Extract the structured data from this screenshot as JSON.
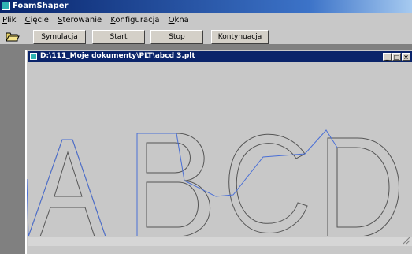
{
  "app": {
    "title": "FoamShaper"
  },
  "menu": [
    {
      "hotkey": "P",
      "rest": "lik"
    },
    {
      "hotkey": "C",
      "rest": "ięcie"
    },
    {
      "hotkey": "S",
      "rest": "terowanie"
    },
    {
      "hotkey": "K",
      "rest": "onfiguracja"
    },
    {
      "hotkey": "O",
      "rest": "kna"
    }
  ],
  "toolbar": {
    "open_icon": "folder-open-icon",
    "simulate_label": "Symulacja",
    "start_label": "Start",
    "stop_label": "Stop",
    "continue_label": "Kontynuacja"
  },
  "document": {
    "path": "D:\\111_Moje dokumenty\\PLT\\abcd 3.plt",
    "minimize": "_",
    "maximize": "□",
    "close": "×",
    "drawing_letters": [
      "A",
      "B",
      "C",
      "D"
    ]
  },
  "colors": {
    "title_active": "#08246b",
    "face": "#c8c8c8",
    "mdi_background": "#808080",
    "outline": "#555555",
    "travel_path": "#4a6fd6"
  }
}
